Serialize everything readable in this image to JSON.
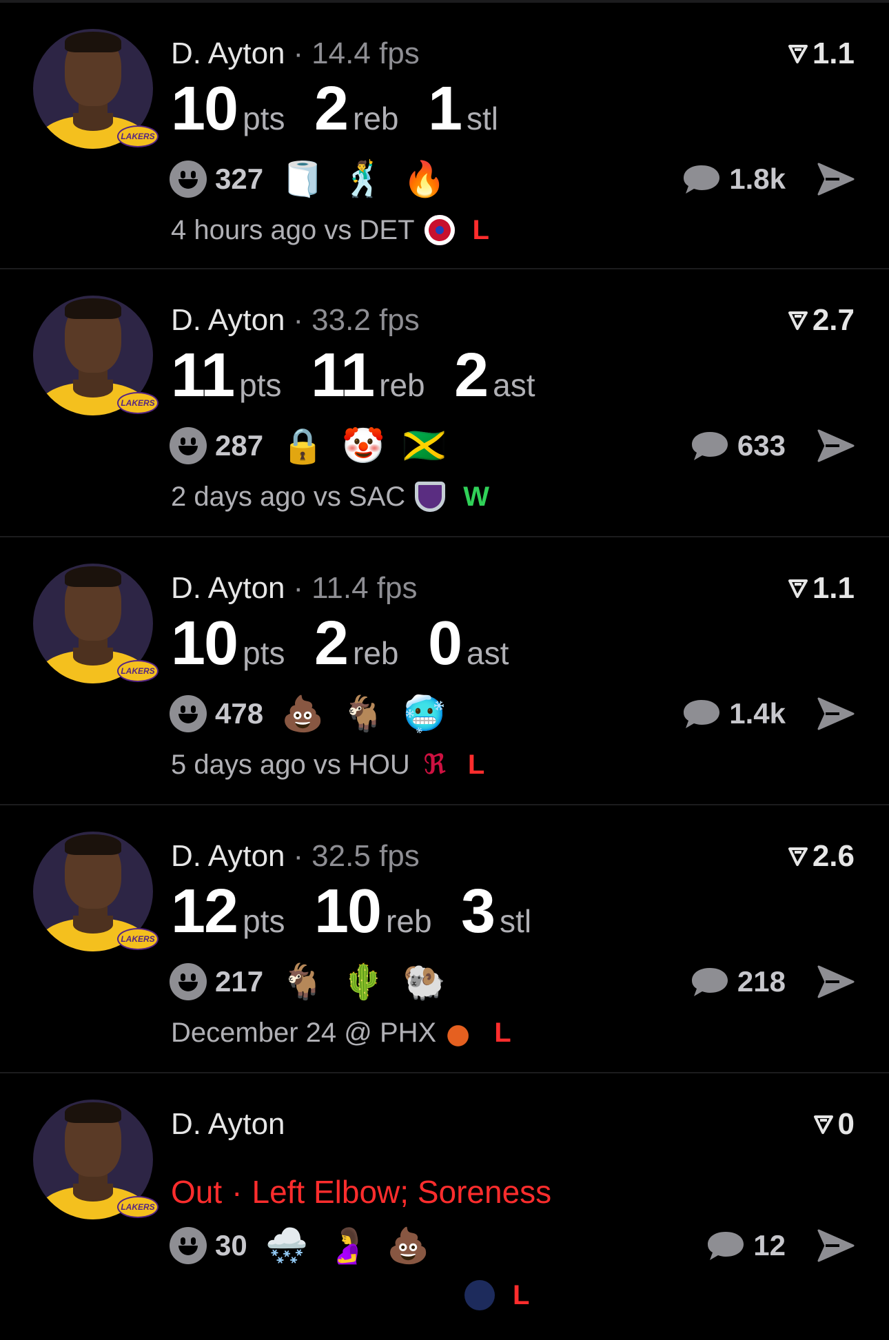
{
  "colors": {
    "loss": "#ff2d2d",
    "win": "#30d158",
    "text_secondary": "#8e8e93"
  },
  "icons": [
    "smiley-reaction-icon",
    "comment-bubble-icon",
    "share-send-icon",
    "rating-arrow-icon",
    "team-logo-icon"
  ],
  "feed": [
    {
      "name": "D. Ayton",
      "fps": "14.4 fps",
      "rating": "1.1",
      "stats": [
        {
          "num": "10",
          "unit": "pts"
        },
        {
          "num": "2",
          "unit": "reb"
        },
        {
          "num": "1",
          "unit": "stl"
        }
      ],
      "reaction_count": "327",
      "emojis": [
        "🧻",
        "🕺",
        "🔥"
      ],
      "comments": "1.8k",
      "meta": "4 hours ago vs DET",
      "team_logo_color": "#1d42ba",
      "result": "L",
      "result_color": "#ff2d2d"
    },
    {
      "name": "D. Ayton",
      "fps": "33.2 fps",
      "rating": "2.7",
      "stats": [
        {
          "num": "11",
          "unit": "pts"
        },
        {
          "num": "11",
          "unit": "reb"
        },
        {
          "num": "2",
          "unit": "ast"
        }
      ],
      "reaction_count": "287",
      "emojis": [
        "🔒",
        "🤡",
        "🇯🇲"
      ],
      "comments": "633",
      "meta": "2 days ago vs SAC",
      "team_logo_color": "#5a2d81",
      "result": "W",
      "result_color": "#30d158"
    },
    {
      "name": "D. Ayton",
      "fps": "11.4 fps",
      "rating": "1.1",
      "stats": [
        {
          "num": "10",
          "unit": "pts"
        },
        {
          "num": "2",
          "unit": "reb"
        },
        {
          "num": "0",
          "unit": "ast"
        }
      ],
      "reaction_count": "478",
      "emojis": [
        "💩",
        "🐐",
        "🥶"
      ],
      "comments": "1.4k",
      "meta": "5 days ago vs HOU",
      "team_logo_color": "#ce1141",
      "result": "L",
      "result_color": "#ff2d2d"
    },
    {
      "name": "D. Ayton",
      "fps": "32.5 fps",
      "rating": "2.6",
      "stats": [
        {
          "num": "12",
          "unit": "pts"
        },
        {
          "num": "10",
          "unit": "reb"
        },
        {
          "num": "3",
          "unit": "stl"
        }
      ],
      "reaction_count": "217",
      "emojis": [
        "🐐",
        "🌵",
        "🐏"
      ],
      "comments": "218",
      "meta": "December 24 @ PHX",
      "team_logo_color": "#e56020",
      "result": "L",
      "result_color": "#ff2d2d"
    },
    {
      "name": "D. Ayton",
      "rating": "0",
      "status": "Out",
      "status_detail": "Left Elbow; Soreness",
      "reaction_count": "30",
      "emojis": [
        "🌨️",
        "🤰",
        "💩"
      ],
      "comments": "12",
      "meta": "",
      "team_logo_color": "#1d2b5c",
      "result": "L",
      "result_color": "#ff2d2d"
    }
  ]
}
